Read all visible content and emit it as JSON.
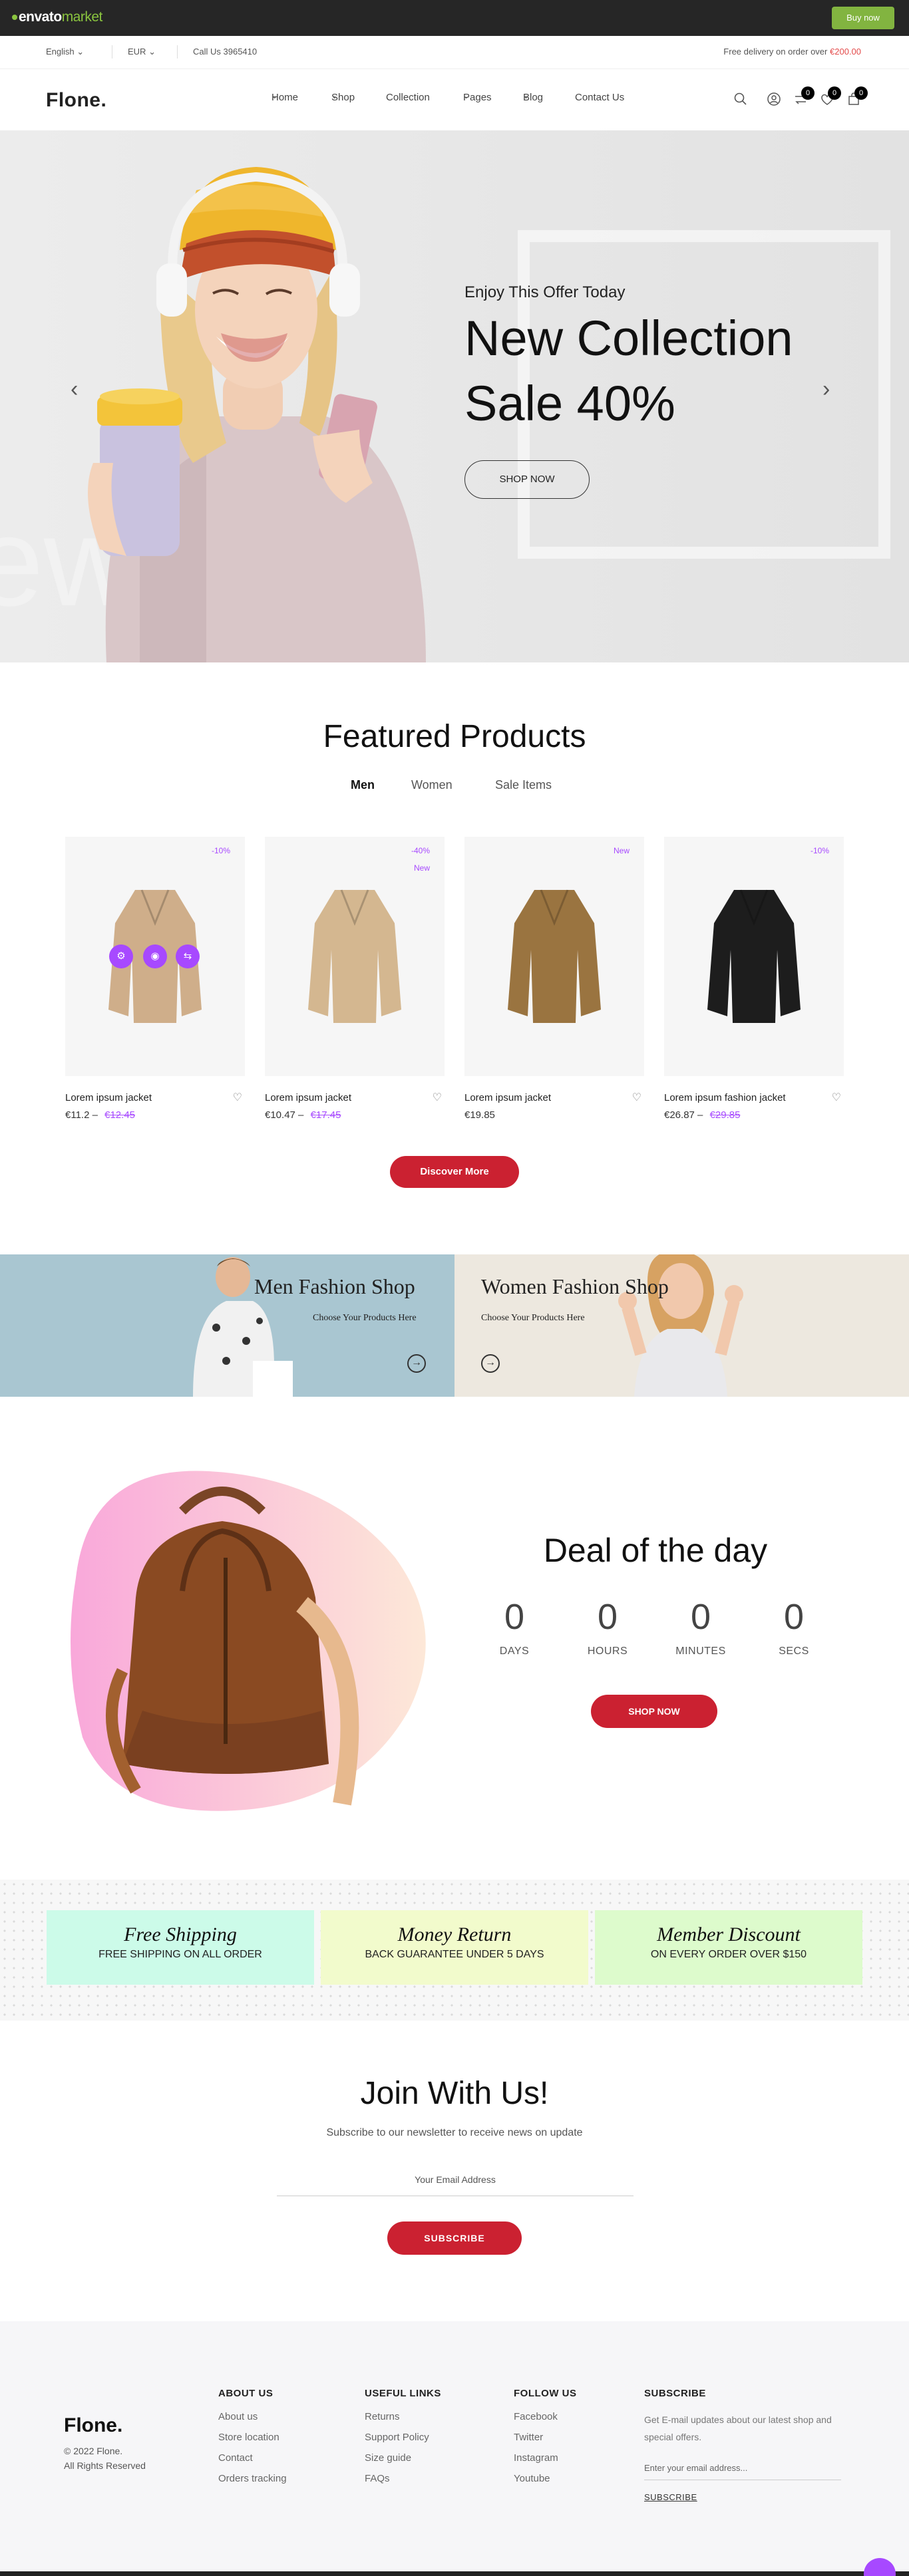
{
  "envato": {
    "logo_word": "envato",
    "logo_market": "market",
    "buy_label": "Buy now"
  },
  "topbar": {
    "language": "English",
    "currency": "EUR",
    "phone": "Call Us 3965410",
    "free_text": "Free delivery on order over",
    "free_amount": "€200.00"
  },
  "header": {
    "brand": "Flone.",
    "nav": [
      "Home",
      "Shop",
      "Collection",
      "Pages",
      "Blog",
      "Contact Us"
    ],
    "badges": {
      "compare": "0",
      "wishlist": "0",
      "cart": "0"
    }
  },
  "hero": {
    "subtitle": "Enjoy This Offer Today",
    "title_line1": "New Collection",
    "title_line2": "Sale 40%",
    "button": "SHOP NOW",
    "ghost_text": "ew Sale"
  },
  "featured": {
    "title": "Featured Products",
    "tabs": [
      "Men",
      "Women",
      "Sale Items"
    ],
    "products": [
      {
        "name": "Lorem ipsum jacket",
        "price": "€11.2",
        "old_price": "€12.45",
        "tags": [
          "-10%"
        ],
        "color": "#cfae8a"
      },
      {
        "name": "Lorem ipsum jacket",
        "price": "€10.47",
        "old_price": "€17.45",
        "tags": [
          "-40%",
          "New"
        ],
        "color": "#d4b790"
      },
      {
        "name": "Lorem ipsum jacket",
        "price": "€19.85",
        "old_price": "",
        "tags": [
          "New"
        ],
        "color": "#9a7440"
      },
      {
        "name": "Lorem ipsum fashion jacket",
        "price": "€26.87",
        "old_price": "€29.85",
        "tags": [
          "-10%"
        ],
        "color": "#1d1d1d"
      }
    ],
    "discover": "Discover More"
  },
  "banners": {
    "men_title": "Men Fashion Shop",
    "men_sub": "Choose Your Products Here",
    "women_title": "Women Fashion Shop",
    "women_sub": "Choose Your Products Here"
  },
  "deal": {
    "title": "Deal of the day",
    "countdown": [
      {
        "value": "0",
        "label": "DAYS"
      },
      {
        "value": "0",
        "label": "HOURS"
      },
      {
        "value": "0",
        "label": "MINUTES"
      },
      {
        "value": "0",
        "label": "SECS"
      }
    ],
    "button": "SHOP NOW"
  },
  "support": [
    {
      "title": "Free Shipping",
      "text": "FREE SHIPPING ON ALL ORDER",
      "color": "#ccfbe9"
    },
    {
      "title": "Money Return",
      "text": "BACK GUARANTEE UNDER 5 DAYS",
      "color": "#f2fbcc"
    },
    {
      "title": "Member Discount",
      "text": "ON EVERY ORDER OVER $150",
      "color": "#ddfbcc"
    }
  ],
  "subscribe": {
    "title": "Join With Us!",
    "subtitle": "Subscribe to our newsletter to receive news on update",
    "placeholder": "Your Email Address",
    "button": "SUBSCRIBE"
  },
  "footer": {
    "brand": "Flone.",
    "copyright": "© 2022 Flone.",
    "rights": "All Rights Reserved",
    "about": {
      "title": "ABOUT US",
      "links": [
        "About us",
        "Store location",
        "Contact",
        "Orders tracking"
      ]
    },
    "useful": {
      "title": "USEFUL LINKS",
      "links": [
        "Returns",
        "Support Policy",
        "Size guide",
        "FAQs"
      ]
    },
    "follow": {
      "title": "FOLLOW US",
      "links": [
        "Facebook",
        "Twitter",
        "Instagram",
        "Youtube"
      ]
    },
    "subscribe": {
      "title": "SUBSCRIBE",
      "text": "Get E-mail updates about our latest shop and special offers.",
      "placeholder": "Enter your email address...",
      "button": "SUBSCRIBE"
    }
  },
  "colors": {
    "accent": "#cb2131",
    "purple": "#a749ff",
    "envato_green": "#82b440"
  }
}
